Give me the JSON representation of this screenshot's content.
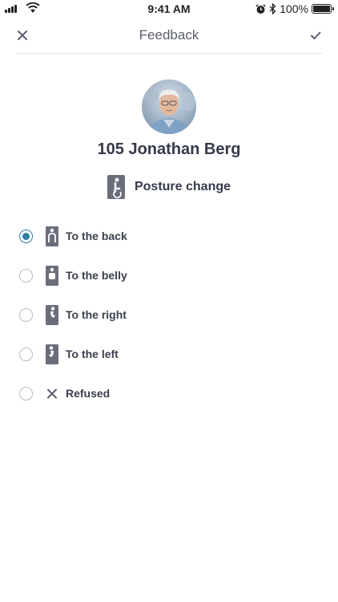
{
  "status_bar": {
    "time": "9:41 AM",
    "battery_text": "100%",
    "battery_level": 1.0,
    "icons": [
      "signal-icon",
      "wifi-icon",
      "alarm-icon",
      "bluetooth-icon",
      "battery-icon"
    ]
  },
  "nav": {
    "title": "Feedback",
    "close_icon": "close-icon",
    "done_icon": "checkmark-icon"
  },
  "patient": {
    "name": "105 Jonathan Berg",
    "avatar": "patient-photo"
  },
  "task": {
    "icon": "posture-change-icon",
    "label": "Posture change"
  },
  "options": [
    {
      "label": "To the back",
      "icon": "posture-back-icon",
      "selected": true
    },
    {
      "label": "To the belly",
      "icon": "posture-belly-icon",
      "selected": false
    },
    {
      "label": "To the right",
      "icon": "posture-right-icon",
      "selected": false
    },
    {
      "label": "To the left",
      "icon": "posture-left-icon",
      "selected": false
    },
    {
      "label": "Refused",
      "icon": "refused-icon",
      "selected": false
    }
  ],
  "colors": {
    "accent": "#2d7ea0",
    "icon": "#6b6e7a",
    "text": "#363a4b"
  }
}
